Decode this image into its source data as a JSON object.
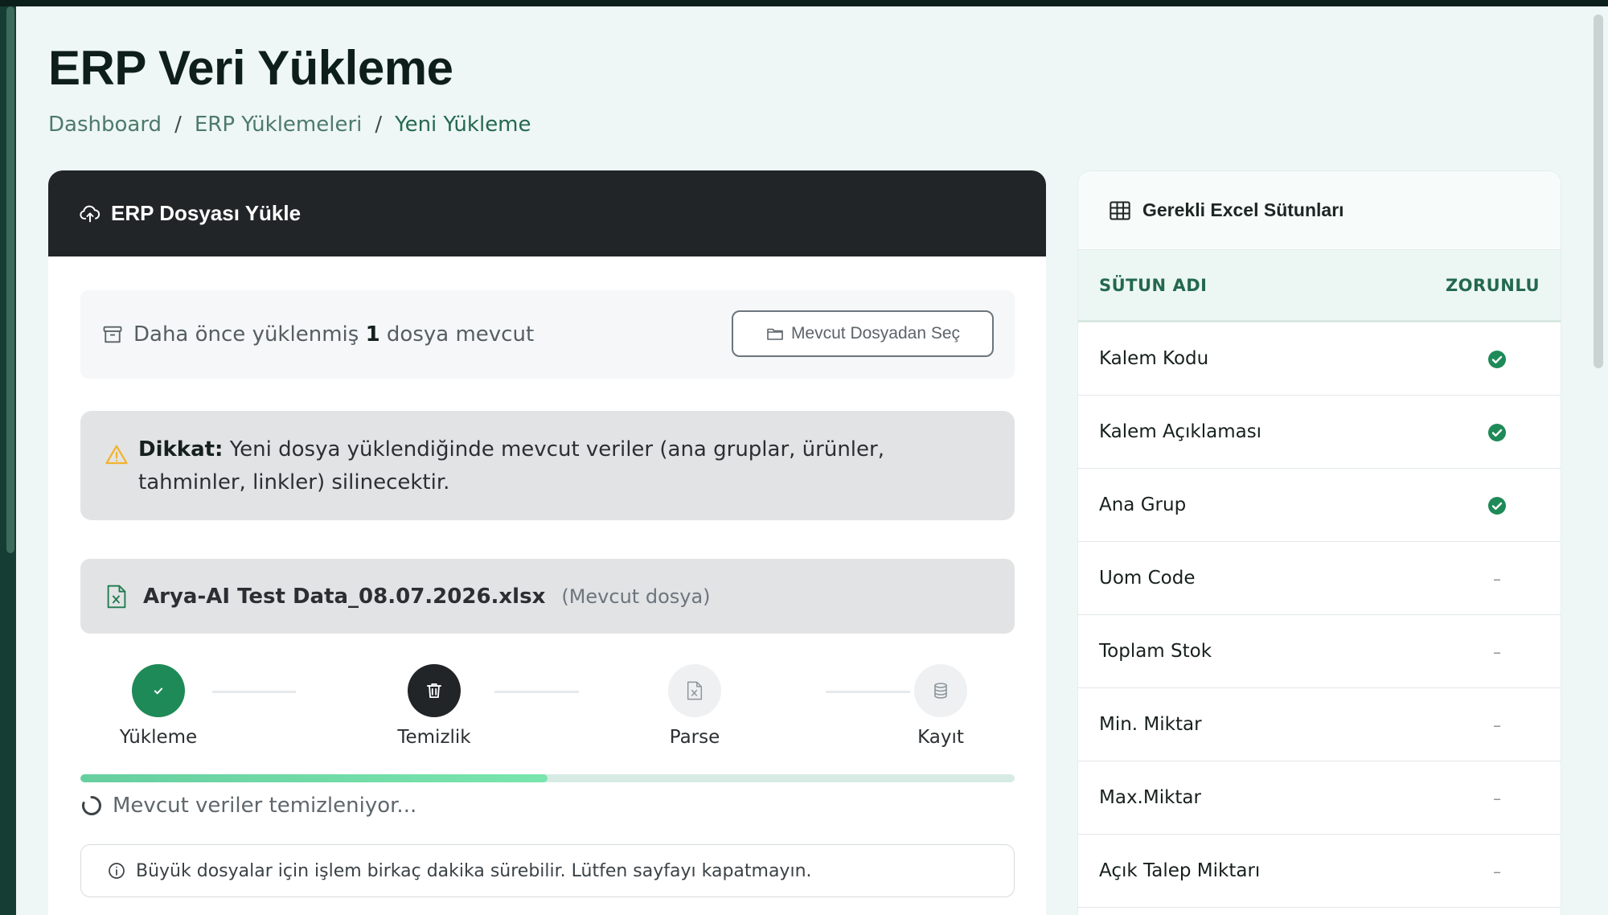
{
  "page": {
    "title": "ERP Veri Yükleme",
    "breadcrumb": [
      "Dashboard",
      "ERP Yüklemeleri",
      "Yeni Yükleme"
    ],
    "separator": "/"
  },
  "upload_card": {
    "header_title": "ERP Dosyası Yükle",
    "header_icon": "cloud-upload-icon",
    "existing": {
      "prefix": "Daha önce yüklenmiş",
      "count": "1",
      "suffix": "dosya mevcut",
      "button_label": "Mevcut Dosyadan Seç"
    },
    "warning": {
      "label": "Dikkat:",
      "text": " Yeni dosya yüklendiğinde mevcut veriler (ana gruplar, ürünler, tahminler, linkler) silinecektir."
    },
    "file": {
      "name": "Arya-AI Test Data_08.07.2026.xlsx",
      "note": "(Mevcut dosya)"
    },
    "steps": [
      {
        "label": "Yükleme",
        "state": "done",
        "icon": "check-icon"
      },
      {
        "label": "Temizlik",
        "state": "active",
        "icon": "trash-icon"
      },
      {
        "label": "Parse",
        "state": "pending",
        "icon": "excel-file-icon"
      },
      {
        "label": "Kayıt",
        "state": "pending",
        "icon": "database-icon"
      }
    ],
    "progress": 0.5,
    "status_text": "Mevcut veriler temizleniyor...",
    "info_text": "Büyük dosyalar için işlem birkaç dakika sürebilir. Lütfen sayfayı kapatmayın."
  },
  "columns_panel": {
    "title": "Gerekli Excel Sütunları",
    "header": {
      "name": "SÜTUN ADI",
      "required": "ZORUNLU"
    },
    "dash": "–",
    "rows": [
      {
        "name": "Kalem Kodu",
        "required": true
      },
      {
        "name": "Kalem Açıklaması",
        "required": true
      },
      {
        "name": "Ana Grup",
        "required": true
      },
      {
        "name": "Uom Code",
        "required": false
      },
      {
        "name": "Toplam Stok",
        "required": false
      },
      {
        "name": "Min. Miktar",
        "required": false
      },
      {
        "name": "Max.Miktar",
        "required": false
      },
      {
        "name": "Açık Talep Miktarı",
        "required": false
      }
    ]
  },
  "colors": {
    "dark": "#212527",
    "brand_green": "#24684f",
    "success": "#1e8a58",
    "warning": "#f1b42f",
    "excel": "#1e7a4c"
  }
}
